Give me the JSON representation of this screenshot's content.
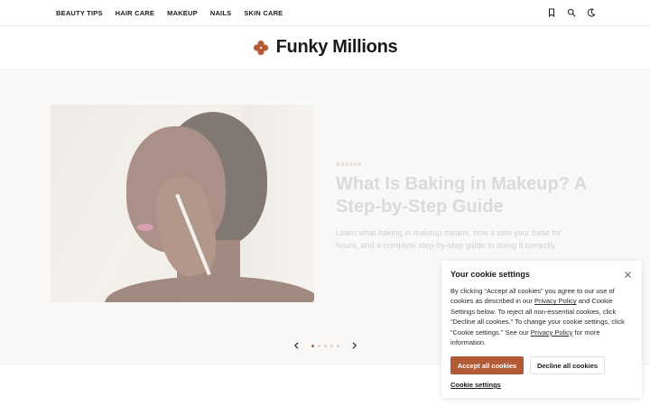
{
  "nav": {
    "items": [
      {
        "label": "BEAUTY TIPS"
      },
      {
        "label": "HAIR CARE"
      },
      {
        "label": "MAKEUP"
      },
      {
        "label": "NAILS"
      },
      {
        "label": "SKIN CARE"
      }
    ],
    "icons": [
      "bookmark-icon",
      "search-icon",
      "moon-icon"
    ]
  },
  "brand": {
    "title": "Funky Millions",
    "logo_icon": "clover-icon",
    "logo_color": "#b35a36"
  },
  "hero": {
    "category": "MAKEUP",
    "title": "What Is Baking in Makeup? A Step-by-Step Guide",
    "excerpt": "Learn what baking in makeup means, how it sets your base for hours, and a complete step-by-step guide to doing it correctly.",
    "slider": {
      "prev_icon": "chevron-left-icon",
      "next_icon": "chevron-right-icon",
      "dot_count": 5,
      "active_index": 0
    }
  },
  "cookie": {
    "title": "Your cookie settings",
    "text_1": "By clicking “Accept all cookies” you agree to our use of cookies as described in our ",
    "link_1": "Privacy Policy",
    "text_2": " and Cookie Settings below. To reject all non-essential cookies, click “Decline all cookies.” To change your cookie settings, click “Cookie settings.” See our ",
    "link_2": "Privacy Policy",
    "text_3": " for more information.",
    "accept_label": "Accept all cookies",
    "decline_label": "Decline all cookies",
    "settings_label": "Cookie settings",
    "accent_color": "#b35a36"
  }
}
